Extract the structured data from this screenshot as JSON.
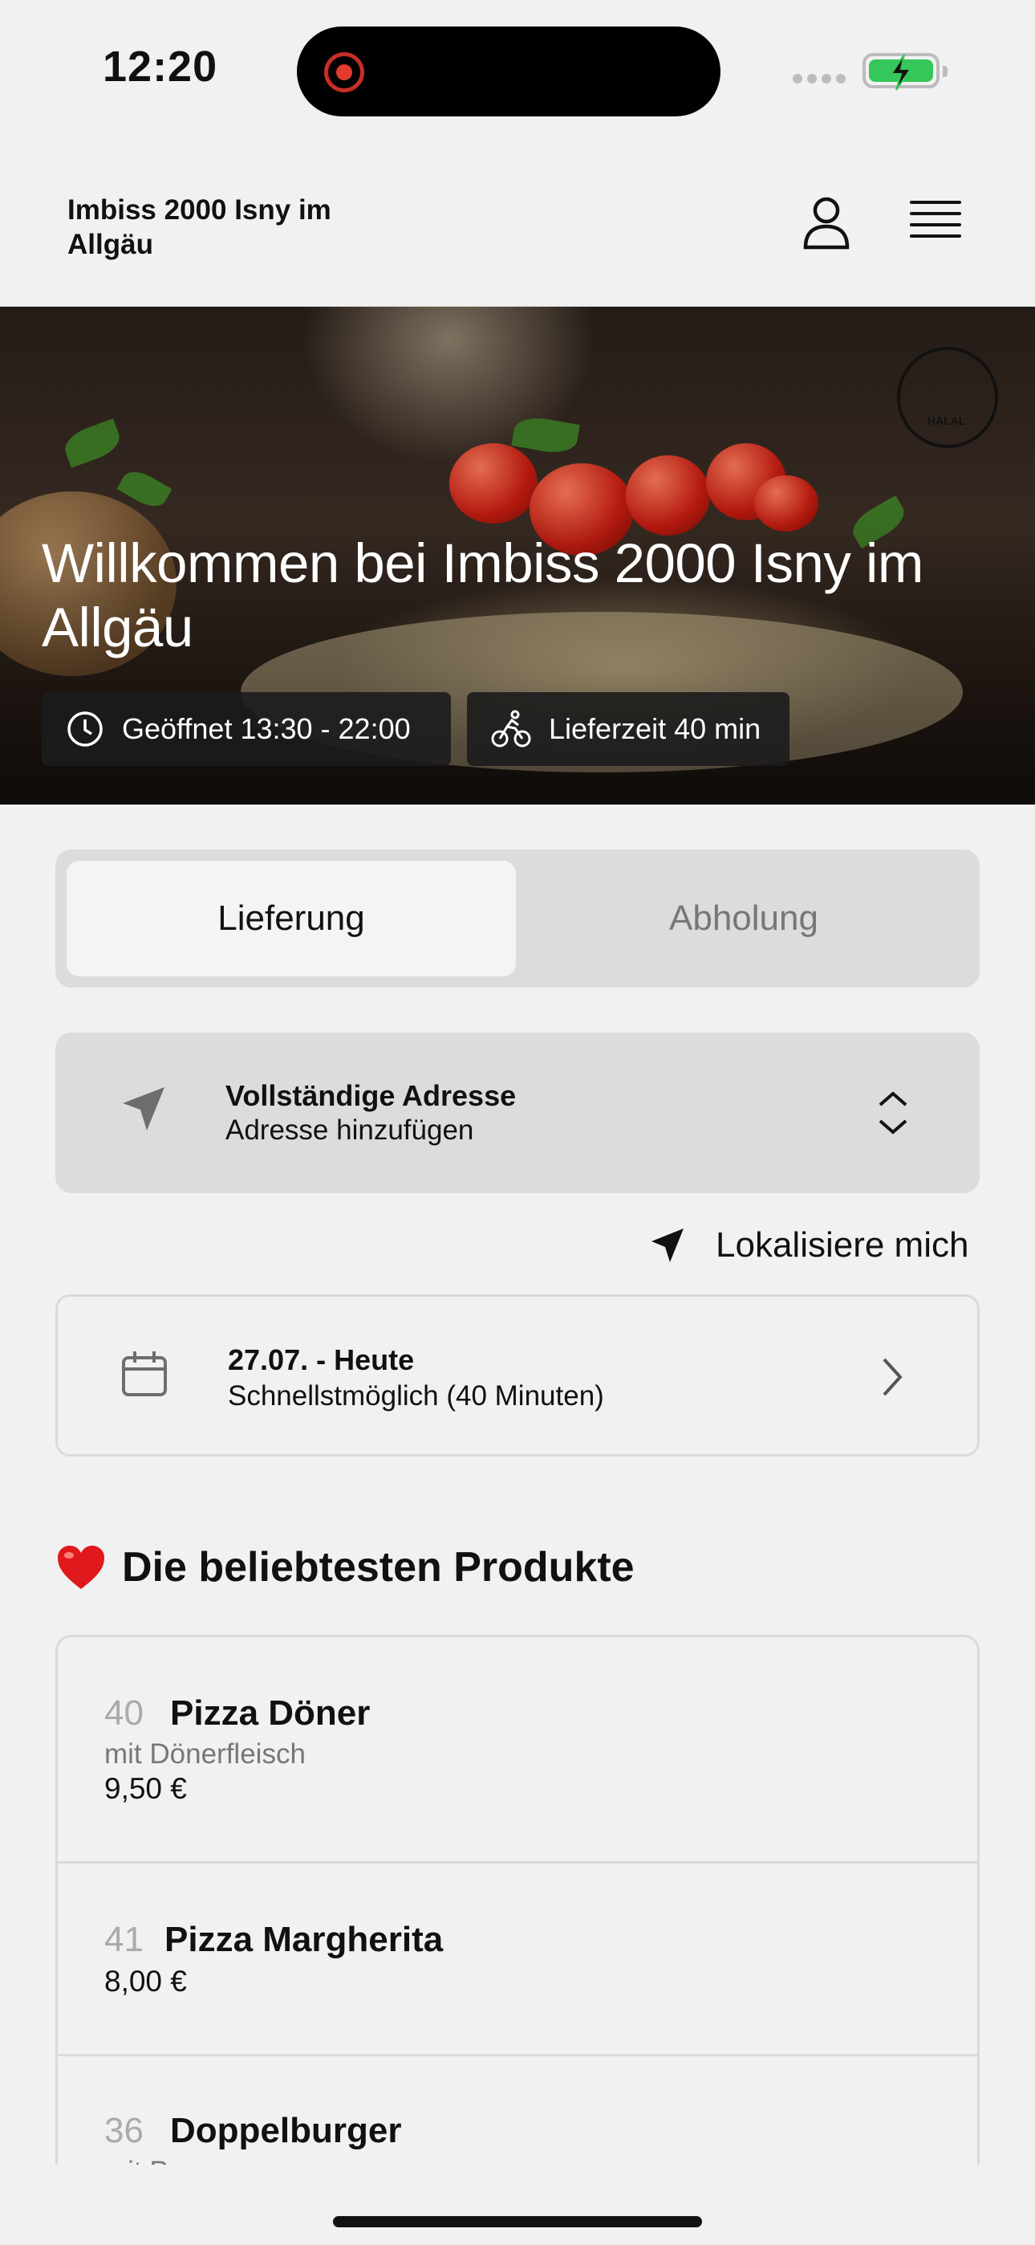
{
  "status_bar": {
    "time": "12:20"
  },
  "header": {
    "restaurant_name": "Imbiss 2000 Isny im Allgäu"
  },
  "hero": {
    "title": "Willkommen bei Imbiss 2000 Isny im Allgäu",
    "opening_hours": "Geöffnet 13:30 - 22:00",
    "delivery_time": "Lieferzeit 40 min",
    "logo_text": "HALAL"
  },
  "order_mode": {
    "tabs": [
      {
        "label": "Lieferung",
        "selected": true
      },
      {
        "label": "Abholung",
        "selected": false
      }
    ]
  },
  "address": {
    "title": "Vollständige Adresse",
    "subtitle": "Adresse hinzufügen"
  },
  "locate_me": {
    "label": "Lokalisiere mich"
  },
  "schedule": {
    "date": "27.07. - Heute",
    "time": "Schnellstmöglich (40 Minuten)"
  },
  "popular": {
    "title": "Die beliebtesten Produkte",
    "products": [
      {
        "number": "40",
        "name": "Pizza Döner",
        "description": "mit Dönerfleisch",
        "price": "9,50 €"
      },
      {
        "number": "41",
        "name": "Pizza Margherita",
        "description": "",
        "price": "8,00 €"
      },
      {
        "number": "36",
        "name": "Doppelburger",
        "description": "mit Pommes",
        "price": ""
      }
    ]
  },
  "colors": {
    "background": "#f1f1f1",
    "segment_bg": "#dcdcdc",
    "text": "#111111",
    "muted": "#777777",
    "battery": "#35c759",
    "record": "#e53a2f"
  }
}
